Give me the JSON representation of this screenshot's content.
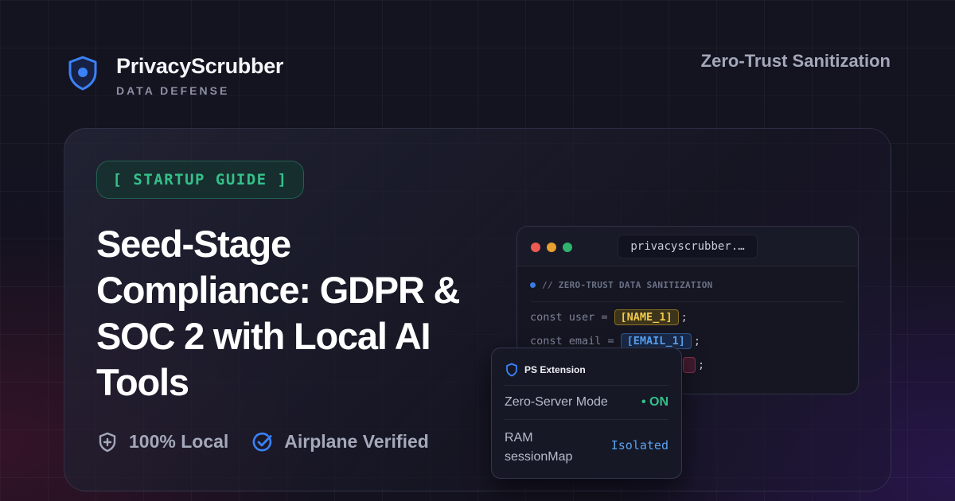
{
  "brand": {
    "name": "PrivacyScrubber",
    "tagline": "DATA DEFENSE",
    "logo_icon": "shield-icon",
    "accent": "#3b82f6"
  },
  "header": {
    "tag": "Zero-Trust Sanitization"
  },
  "hero": {
    "badge": "[ STARTUP GUIDE ]",
    "headline": "Seed-Stage Compliance: GDPR & SOC 2 with Local AI Tools",
    "features": [
      {
        "icon": "shield-plus-icon",
        "label": "100% Local"
      },
      {
        "icon": "check-circle-icon",
        "label": "Airplane Verified"
      }
    ]
  },
  "editor": {
    "window_controls": [
      "close",
      "minimize",
      "maximize"
    ],
    "url": "privacyscrubber.…",
    "comment": "// ZERO-TRUST DATA SANITIZATION",
    "lines": [
      {
        "code": "const user =",
        "token": "[NAME_1]",
        "end": ";",
        "token_color": "#f2c94c"
      },
      {
        "code": "const email =",
        "token": "[EMAIL_1]",
        "end": ";",
        "token_color": "#5aa2f2"
      },
      {
        "code": "",
        "token": "",
        "end": ";",
        "token_color": "#e07a9a"
      }
    ]
  },
  "extension": {
    "title": "PS Extension",
    "rows": [
      {
        "label": "Zero-Server Mode",
        "value": "• ON",
        "value_color": "#34c08a"
      },
      {
        "label": "RAM sessionMap",
        "value": "Isolated",
        "value_color": "#5aa2f2"
      }
    ]
  }
}
